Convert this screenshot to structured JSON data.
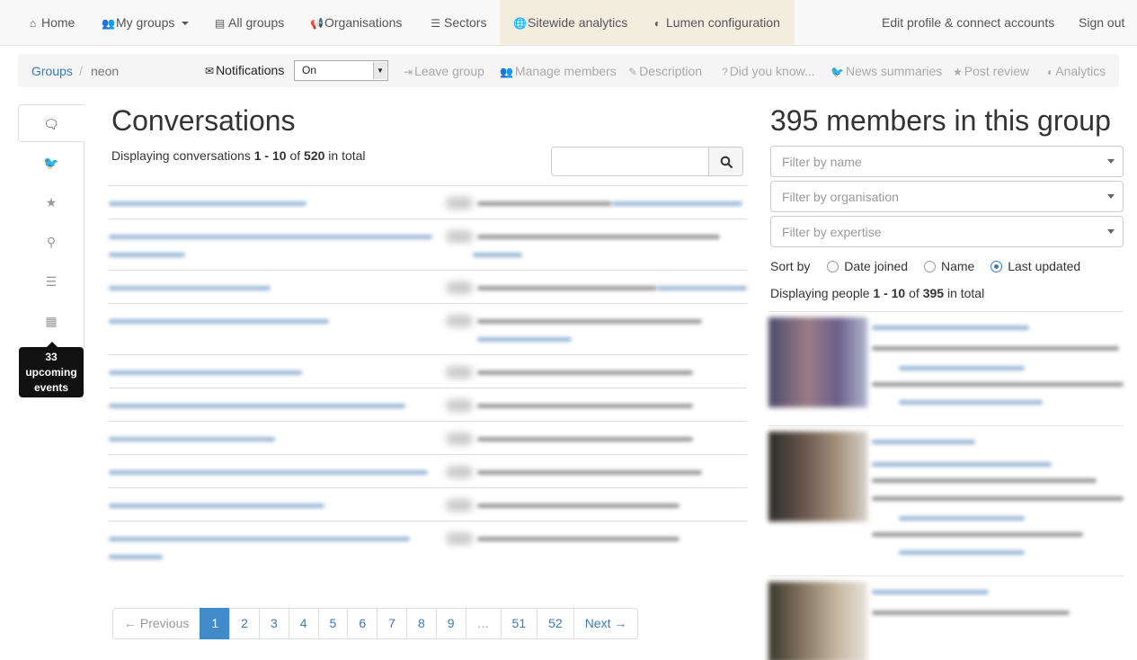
{
  "nav": {
    "home": "Home",
    "my_groups": "My groups",
    "all_groups": "All groups",
    "organisations": "Organisations",
    "sectors": "Sectors",
    "sitewide_analytics": "Sitewide analytics",
    "lumen_configuration": "Lumen configuration",
    "edit_profile": "Edit profile & connect accounts",
    "sign_out": "Sign out"
  },
  "breadcrumb": {
    "groups": "Groups",
    "separator": "/",
    "current": "neon"
  },
  "notifications": {
    "label": "Notifications",
    "value": "On"
  },
  "group_actions": {
    "leave_group": "Leave group",
    "manage_members": "Manage members",
    "description": "Description",
    "did_you_know": "Did you know...",
    "news_summaries": "News summaries",
    "post_review": "Post review",
    "analytics": "Analytics"
  },
  "events_tooltip": {
    "count": "33",
    "line1": "upcoming",
    "line2": "events"
  },
  "conversations": {
    "title": "Conversations",
    "displaying_prefix": "Displaying conversations",
    "range": "1 - 10",
    "of": "of",
    "total": "520",
    "suffix": "in total",
    "search_placeholder": ""
  },
  "pagination": {
    "previous": "← Previous",
    "pages": [
      "1",
      "2",
      "3",
      "4",
      "5",
      "6",
      "7",
      "8",
      "9",
      "…",
      "51",
      "52"
    ],
    "active_page": "1",
    "next": "Next →"
  },
  "members": {
    "title": "395 members in this group",
    "filter_name": "Filter by name",
    "filter_org": "Filter by organisation",
    "filter_expertise": "Filter by expertise",
    "sort_label": "Sort by",
    "sort_date_joined": "Date joined",
    "sort_name": "Name",
    "sort_last_updated": "Last updated",
    "selected_sort": "Last updated",
    "displaying_prefix": "Displaying people",
    "range": "1 - 10",
    "of": "of",
    "total": "395",
    "suffix": "in total"
  },
  "colors": {
    "link": "#3a7ab8",
    "active_page": "#428bca",
    "nav_active": "#f3ede0"
  },
  "icons": [
    "home-icon",
    "users-icon",
    "book-icon",
    "bullhorn-icon",
    "list-icon",
    "globe-icon",
    "dashboard-icon",
    "envelope-icon",
    "search-icon",
    "comments-icon",
    "twitter-icon",
    "star-icon",
    "map-marker-icon",
    "calendar-icon"
  ]
}
